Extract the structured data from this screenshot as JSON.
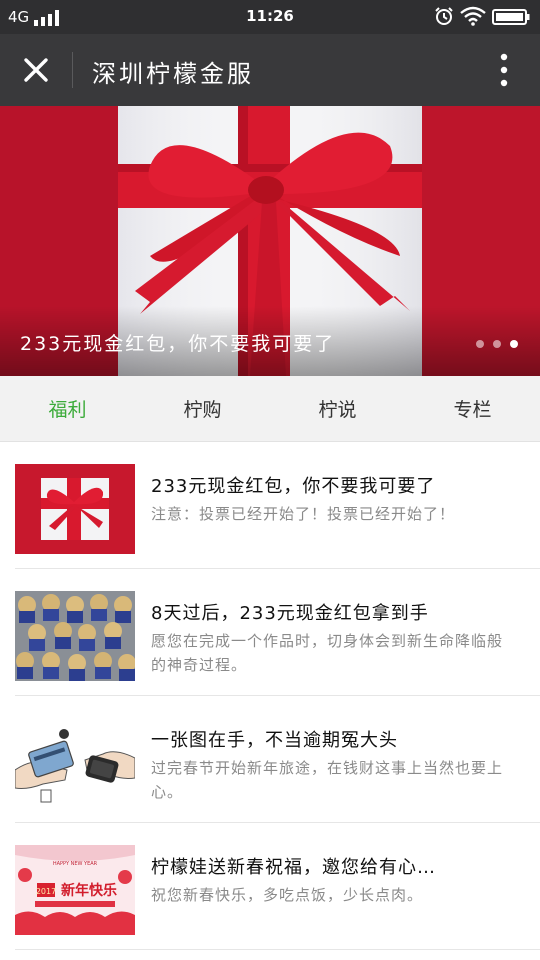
{
  "status_bar": {
    "network": "4G",
    "time": "11:26"
  },
  "nav_bar": {
    "title": "深圳柠檬金服"
  },
  "banner": {
    "caption": "233元现金红包，你不要我可要了",
    "slide_count": 3,
    "active_slide": 3
  },
  "tabs": [
    {
      "label": "福利",
      "active": true
    },
    {
      "label": "柠购",
      "active": false
    },
    {
      "label": "柠说",
      "active": false
    },
    {
      "label": "专栏",
      "active": false
    }
  ],
  "articles": [
    {
      "title": "233元现金红包，你不要我可要了",
      "desc": "注意：投票已经开始了！投票已经开始了！"
    },
    {
      "title": "8天过后，233元现金红包拿到手",
      "desc": "愿您在完成一个作品时，切身体会到新生命降临般的神奇过程。"
    },
    {
      "title": "一张图在手，不当逾期冤大头",
      "desc": "过完春节开始新年旅途，在钱财这事上当然也要上心。"
    },
    {
      "title": "柠檬娃送新春祝福，邀您给有心…",
      "desc": "祝您新春快乐，多吃点饭，少长点肉。"
    }
  ],
  "thumb_text": {
    "year": "2017",
    "greeting": "新年快乐",
    "small_caption": "HAPPY NEW YEAR"
  }
}
